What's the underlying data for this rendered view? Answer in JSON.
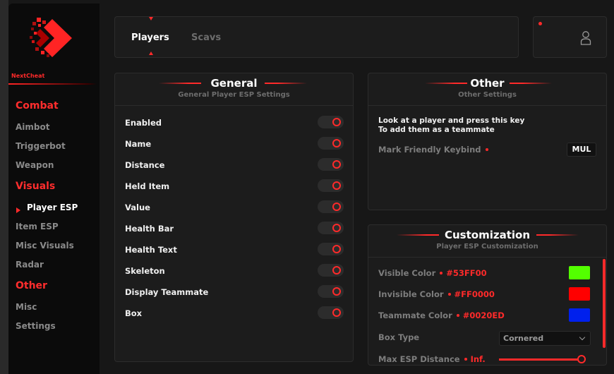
{
  "app": {
    "brand": "NextCheat"
  },
  "sidebar": {
    "sections": [
      {
        "title": "Combat",
        "items": [
          "Aimbot",
          "Triggerbot",
          "Weapon"
        ]
      },
      {
        "title": "Visuals",
        "items": [
          "Player ESP",
          "Item ESP",
          "Misc Visuals",
          "Radar"
        ],
        "active": "Player ESP"
      },
      {
        "title": "Other",
        "items": [
          "Misc",
          "Settings"
        ]
      }
    ]
  },
  "tabs": {
    "players": "Players",
    "scavs": "Scavs",
    "active": "Players"
  },
  "general": {
    "title": "General",
    "subtitle": "General Player ESP Settings",
    "toggles": [
      {
        "label": "Enabled",
        "on": false
      },
      {
        "label": "Name",
        "on": false
      },
      {
        "label": "Distance",
        "on": false
      },
      {
        "label": "Held Item",
        "on": false
      },
      {
        "label": "Value",
        "on": false
      },
      {
        "label": "Health Bar",
        "on": false
      },
      {
        "label": "Health Text",
        "on": false
      },
      {
        "label": "Skeleton",
        "on": false
      },
      {
        "label": "Display Teammate",
        "on": false
      },
      {
        "label": "Box",
        "on": false
      }
    ]
  },
  "other": {
    "title": "Other",
    "subtitle": "Other Settings",
    "desc_line1": "Look at a player and press this key",
    "desc_line2": "To add them as a teammate",
    "keybind_label": "Mark Friendly Keybind",
    "keybind_value": "MUL"
  },
  "customization": {
    "title": "Customization",
    "subtitle": "Player ESP Customization",
    "colors": [
      {
        "label": "Visible Color",
        "hex": "#53FF00"
      },
      {
        "label": "Invisible Color",
        "hex": "#FF0000"
      },
      {
        "label": "Teammate Color",
        "hex": "#0020ED"
      }
    ],
    "box_type_label": "Box Type",
    "box_type_value": "Cornered",
    "max_distance_label": "Max ESP Distance",
    "max_distance_value": "Inf.",
    "max_distance_fraction": 0.93
  },
  "theme": {
    "accent": "#ff2a2a",
    "panel": "#1c1c1c",
    "background": "#171717"
  }
}
